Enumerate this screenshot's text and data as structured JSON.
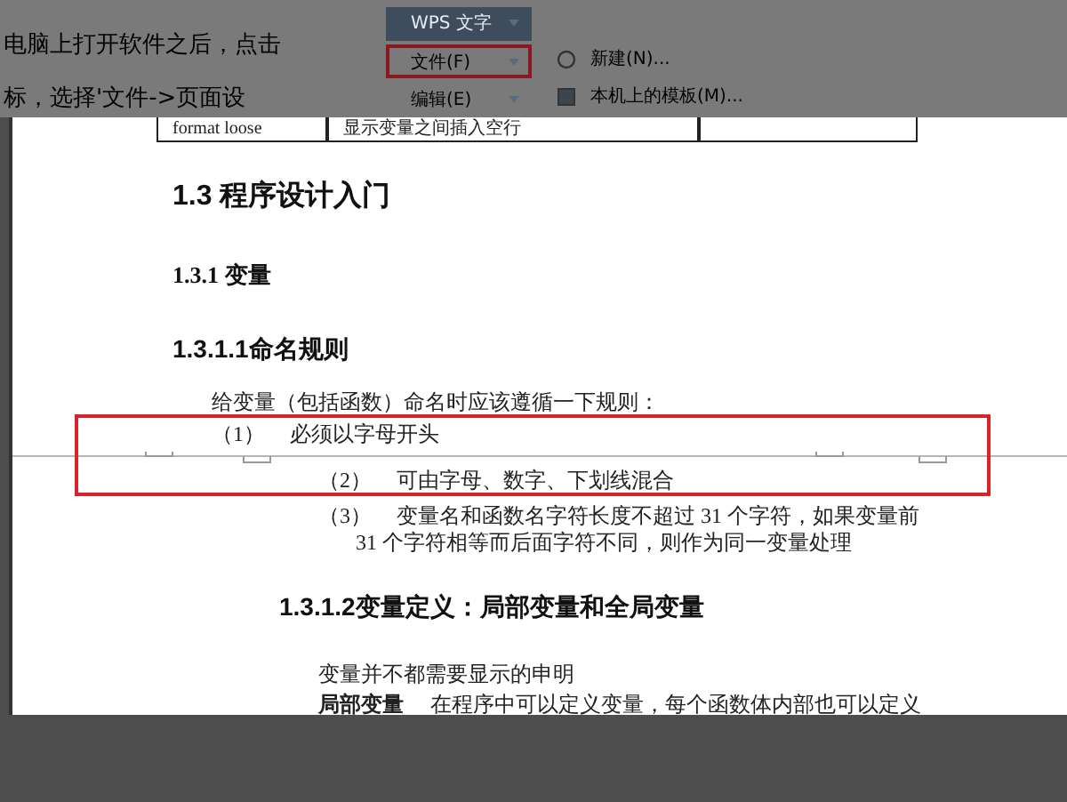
{
  "overlay_top": {
    "left_lines": [
      "电脑上打开软件之后，点击",
      "标，选择'文件->页面设"
    ],
    "menu": [
      {
        "label": "WPS 文字",
        "kind": "app"
      },
      {
        "label": "文件(F)",
        "kind": "highlighted"
      },
      {
        "label": "编辑(E)",
        "kind": "plain"
      }
    ],
    "submenu": [
      {
        "label": "新建(N)...",
        "kind": "new"
      },
      {
        "label": "本机上的模板(M)...",
        "kind": "template"
      }
    ]
  },
  "table_row": {
    "cells": [
      "format loose",
      "显示变量之间插入空行"
    ]
  },
  "pages": [
    {
      "blocks": [
        {
          "kind": "heading1",
          "text": "1.3  程序设计入门"
        },
        {
          "kind": "heading2",
          "text": "1.3.1  变量"
        },
        {
          "kind": "heading3",
          "text": "1.3.1.1命名规则"
        },
        {
          "kind": "para",
          "text": "给变量（包括函数）命名时应该遵循一下规则："
        },
        {
          "kind": "list_item",
          "number": "（1）",
          "text": "必须以字母开头"
        }
      ]
    },
    {
      "blocks": [
        {
          "kind": "list_item",
          "number": "（2）",
          "text": "可由字母、数字、下划线混合"
        },
        {
          "kind": "list_item",
          "number": "（3）",
          "text": "变量名和函数名字符长度不超过 31 个字符，如果变量前"
        },
        {
          "kind": "continuation",
          "text": "31 个字符相等而后面字符不同，则作为同一变量处理"
        },
        {
          "kind": "heading3",
          "text": "1.3.1.2变量定义：局部变量和全局变量"
        },
        {
          "kind": "para",
          "text": "变量并不都需要显示的申明"
        },
        {
          "kind": "para",
          "text": "**局部变量**　 在程序中可以定义变量，每个函数体内部也可以定义"
        }
      ]
    }
  ],
  "annotation": {
    "kind": "highlight_box"
  }
}
